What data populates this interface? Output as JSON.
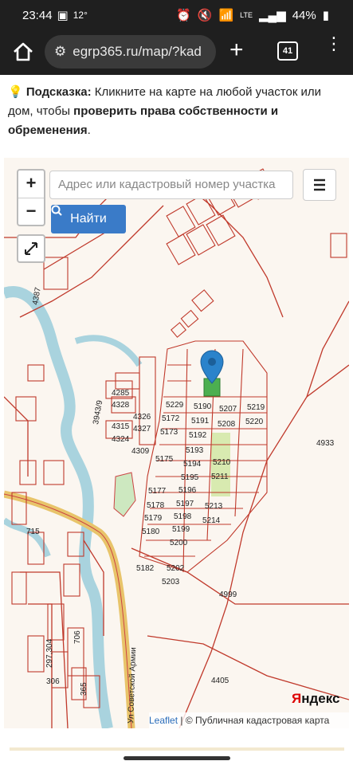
{
  "status_bar": {
    "time": "23:44",
    "temp": "12°",
    "battery": "44%",
    "net": "LTE"
  },
  "browser": {
    "url": "egrp365.ru/map/?kad",
    "tab_count": "41"
  },
  "hint": {
    "icon": "lightbulb-icon",
    "label": "Подсказка:",
    "text1": "Кликните на карте на любой участок или дом, чтобы ",
    "bold": "проверить права собственности и обременения",
    "end": "."
  },
  "map": {
    "zoom_in": "+",
    "zoom_out": "−",
    "search_placeholder": "Адрес или кадастровый номер участка",
    "find_label": "Найти",
    "yandex_logo": "Яндекс",
    "attribution_leaflet": "Leaflet",
    "attribution_sep": " | © ",
    "attribution_public": "Публичная кадастровая карта",
    "parcel_labels": [
      "4285",
      "4328",
      "4326",
      "4327",
      "4315",
      "4324",
      "4309",
      "5229",
      "5190",
      "5207",
      "5219",
      "5172",
      "5191",
      "5208",
      "5220",
      "5173",
      "5192",
      "5193",
      "5175",
      "5194",
      "5210",
      "5195",
      "5211",
      "5177",
      "5196",
      "5178",
      "5197",
      "5213",
      "5179",
      "5198",
      "5214",
      "5180",
      "5199",
      "5200",
      "5182",
      "5202",
      "5203",
      "4933",
      "4999",
      "4405",
      "3943/9",
      "4387",
      "715",
      "706",
      "297,304",
      "306",
      "365"
    ],
    "street_label": "Ул Советской Армии"
  }
}
